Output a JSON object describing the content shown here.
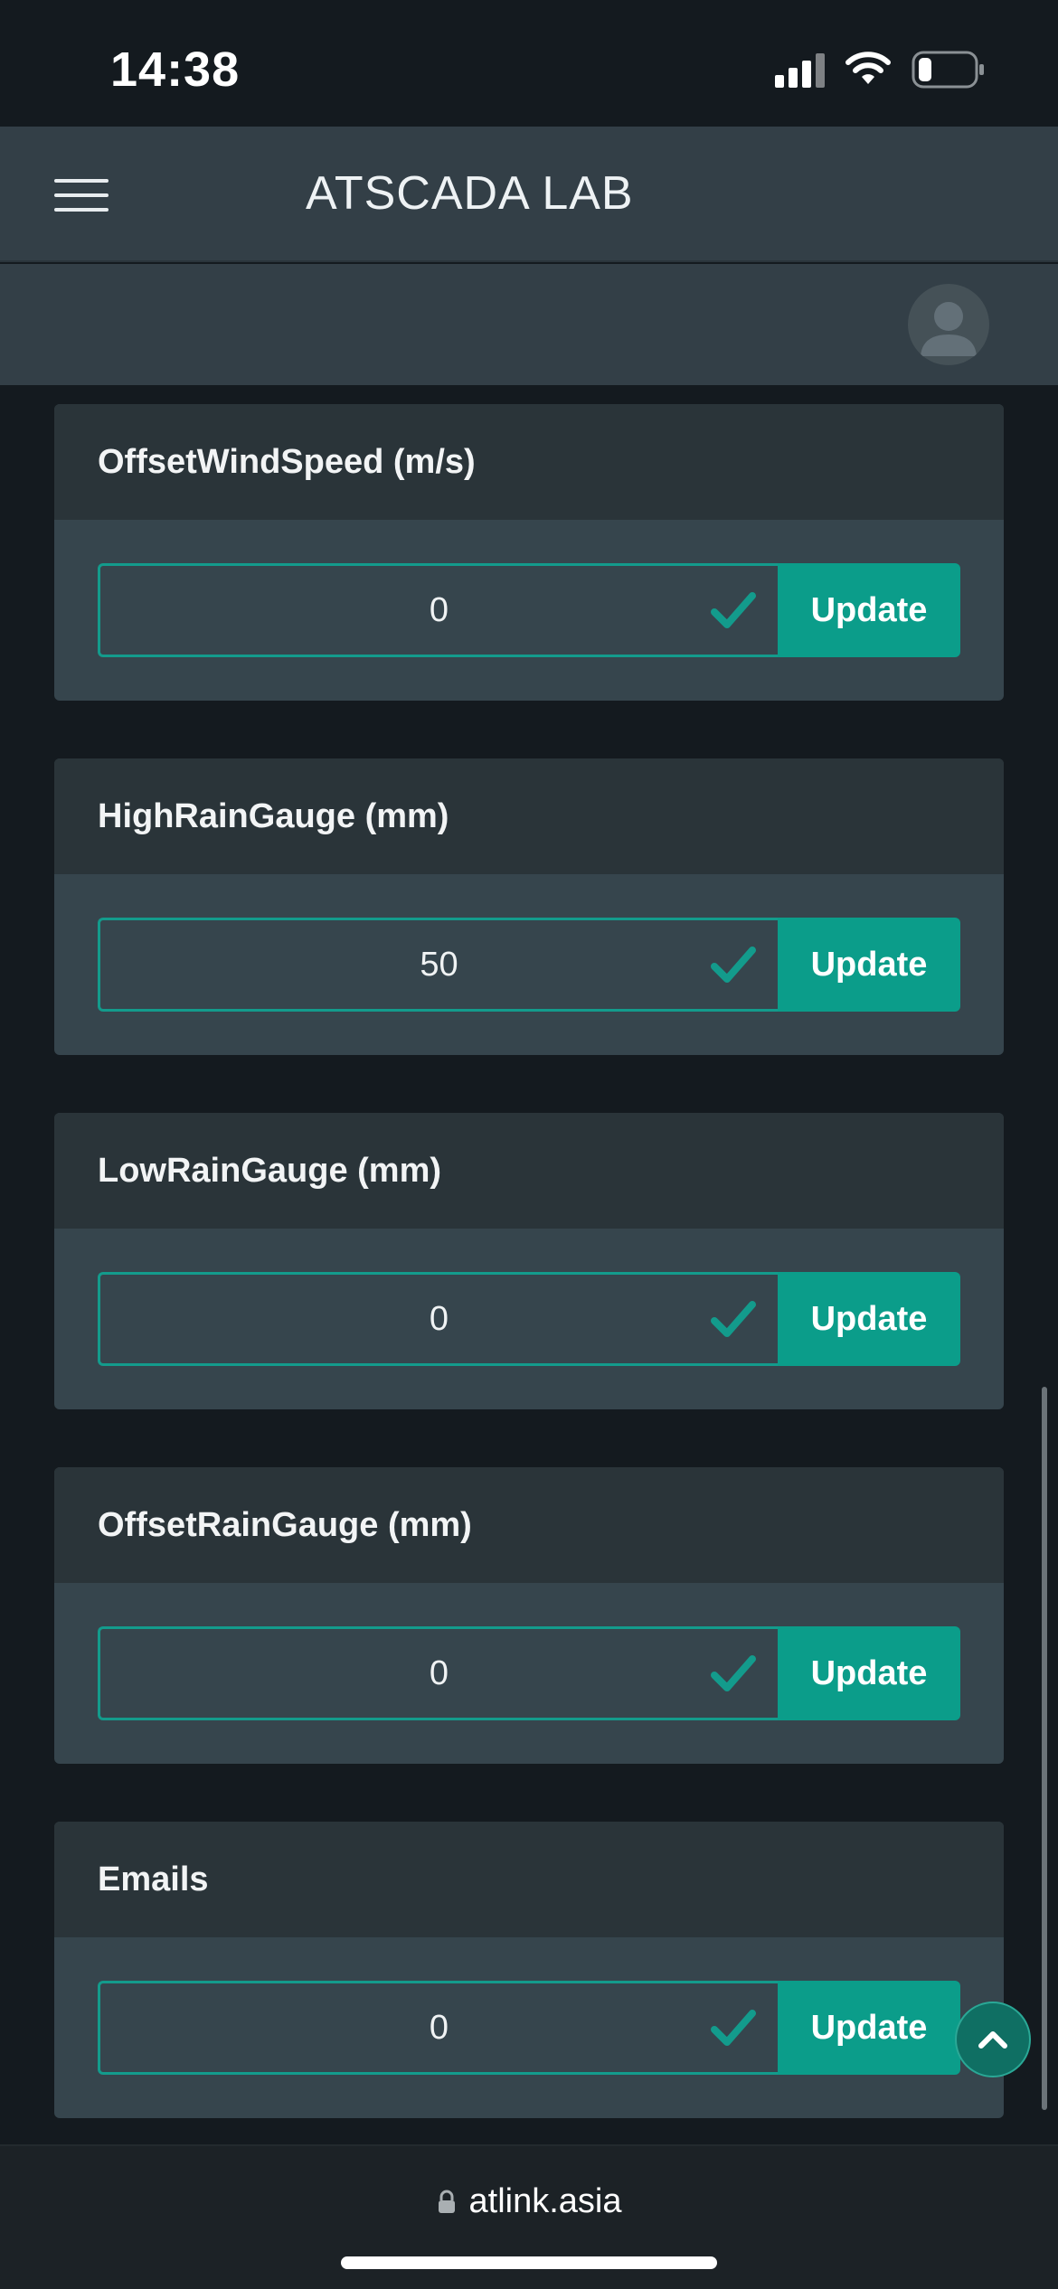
{
  "status_bar": {
    "time": "14:38"
  },
  "header": {
    "title": "ATSCADA LAB",
    "menu_icon": "hamburger-icon",
    "avatar_icon": "user-avatar-icon"
  },
  "cards": [
    {
      "title": "OffsetWindSpeed (m/s)",
      "value": "0",
      "button": "Update"
    },
    {
      "title": "HighRainGauge (mm)",
      "value": "50",
      "button": "Update"
    },
    {
      "title": "LowRainGauge (mm)",
      "value": "0",
      "button": "Update"
    },
    {
      "title": "OffsetRainGauge (mm)",
      "value": "0",
      "button": "Update"
    },
    {
      "title": "Emails",
      "value": "0",
      "button": "Update"
    }
  ],
  "browser": {
    "url": "atlink.asia",
    "lock_icon": "lock-icon"
  },
  "colors": {
    "accent": "#0b9d8a",
    "header_bg": "#333f47",
    "card_bg": "#36454d",
    "card_header_bg": "#2a3439",
    "page_bg": "#141a1f"
  }
}
